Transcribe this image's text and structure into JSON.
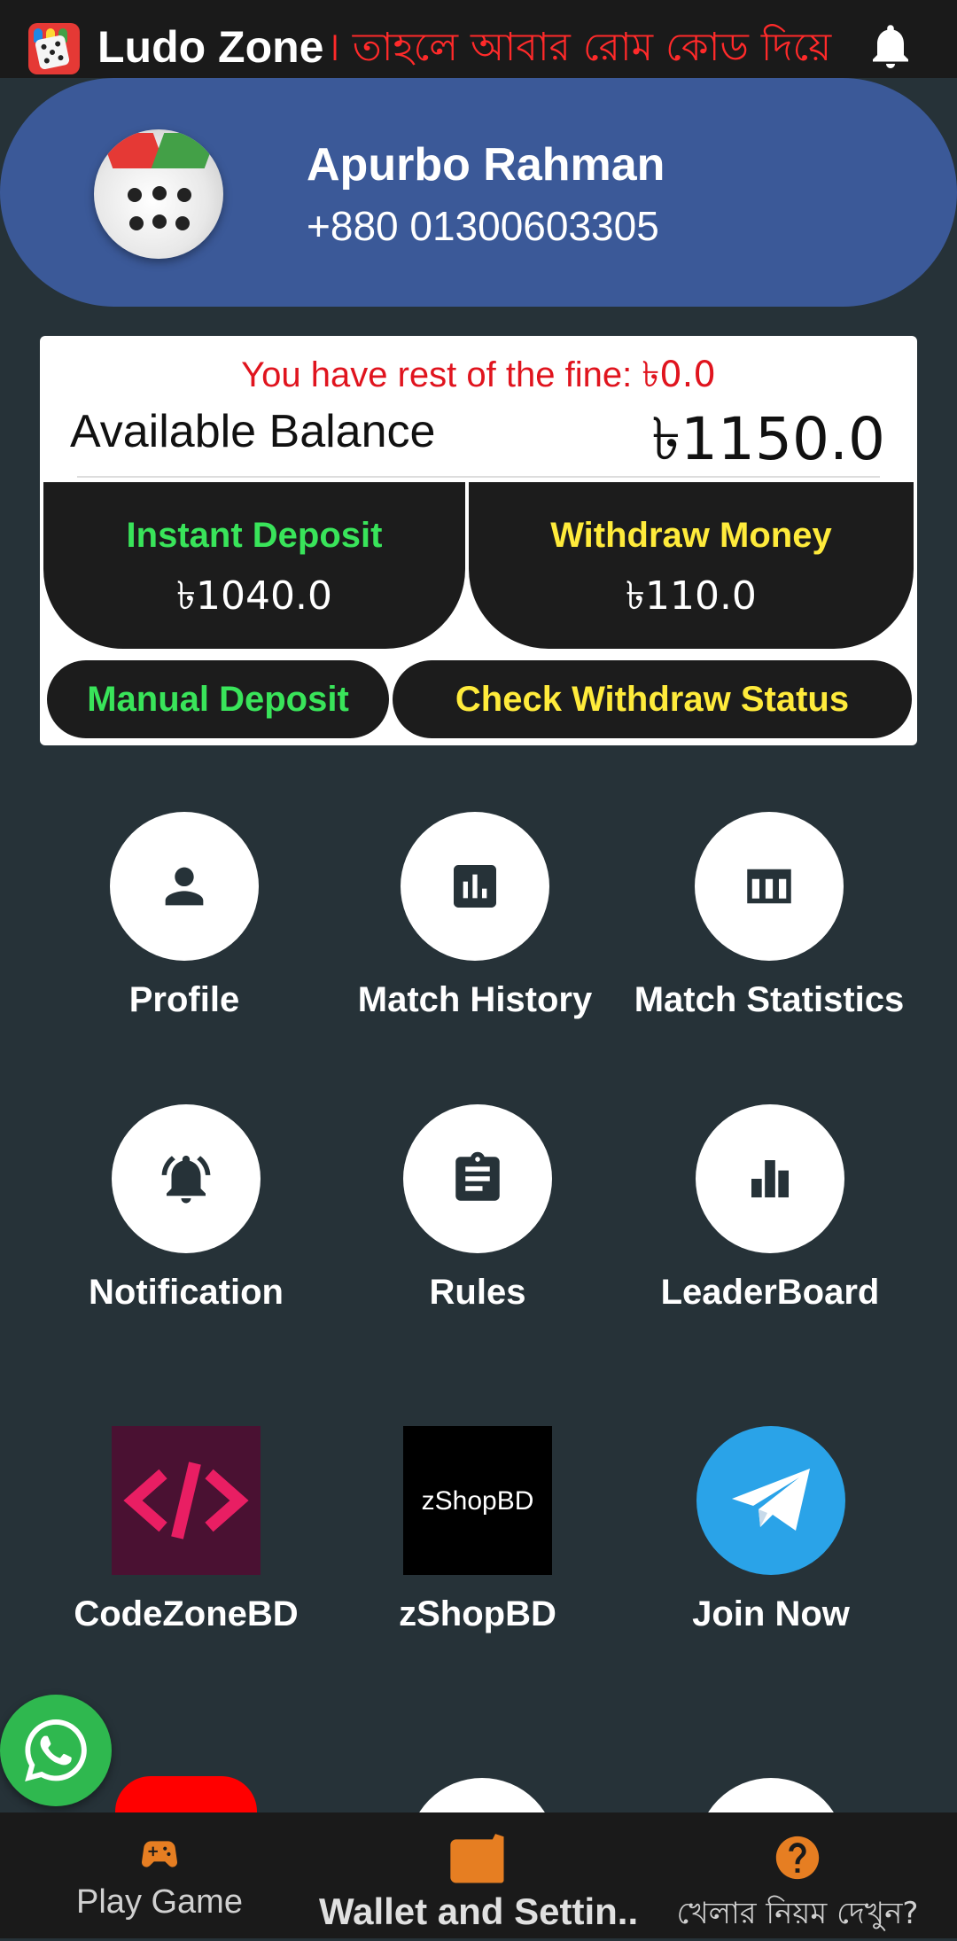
{
  "app": {
    "title": "Ludo Zone",
    "marquee": "। তাহলে আবার রোম কোড দিয়ে"
  },
  "profile": {
    "name": "Apurbo Rahman",
    "phone": "+880 01300603305"
  },
  "wallet": {
    "fine_label": "You have rest of the fine:",
    "fine_amount": "৳0.0",
    "balance_label": "Available Balance",
    "balance_value": "৳1150.0",
    "deposit_label": "Instant Deposit",
    "deposit_amount": "৳1040.0",
    "withdraw_label": "Withdraw Money",
    "withdraw_amount": "৳110.0",
    "manual_deposit": "Manual Deposit",
    "check_withdraw": "Check Withdraw Status"
  },
  "menu": {
    "profile": "Profile",
    "match_history": "Match History",
    "match_statistics": "Match Statistics",
    "notification": "Notification",
    "rules": "Rules",
    "leaderboard": "LeaderBoard",
    "codezonebd": "CodeZoneBD",
    "zshopbd": "zShopBD",
    "join_now": "Join Now"
  },
  "logos": {
    "zshop_text": "zShopBD"
  },
  "bottom_nav": {
    "play": "Play Game",
    "wallet": "Wallet and Settin...",
    "rules": "খেলার নিয়ম দেখুন?"
  },
  "colors": {
    "background": "#263238",
    "header": "#3b5998",
    "deposit_green": "#39e45a",
    "withdraw_yellow": "#ffeb3b",
    "fine_red": "#e0141e",
    "nav_icon": "#e67e22"
  },
  "icons": [
    "bell-icon",
    "person-icon",
    "bar-chart-box-icon",
    "table-icon",
    "notification-bell-icon",
    "clipboard-icon",
    "leaderboard-icon",
    "code-icon",
    "telegram-icon",
    "whatsapp-icon",
    "gamepad-icon",
    "wallet-icon",
    "help-icon"
  ]
}
